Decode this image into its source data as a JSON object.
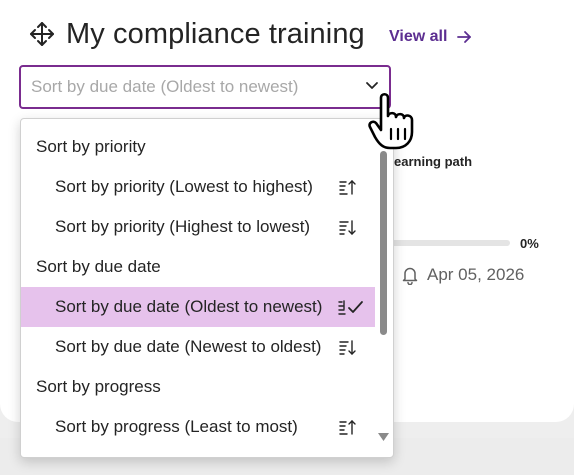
{
  "header": {
    "title": "My compliance training",
    "view_all": "View all"
  },
  "sort_select": {
    "placeholder": "Sort by due date (Oldest to newest)"
  },
  "background_card": {
    "learning_path": "earning path",
    "progress_percent": "0%",
    "due_date": "Apr 05, 2026"
  },
  "dropdown": {
    "groups": [
      {
        "label": "Sort by priority",
        "options": [
          {
            "label": "Sort by priority (Lowest to highest)",
            "icon": "sort-ascending-icon",
            "selected": false
          },
          {
            "label": "Sort by priority (Highest to lowest)",
            "icon": "sort-descending-icon",
            "selected": false
          }
        ]
      },
      {
        "label": "Sort by due date",
        "options": [
          {
            "label": "Sort by due date (Oldest to newest)",
            "icon": "sort-ascending-icon",
            "selected": true
          },
          {
            "label": "Sort by due date (Newest to oldest)",
            "icon": "sort-descending-icon",
            "selected": false
          }
        ]
      },
      {
        "label": "Sort by progress",
        "options": [
          {
            "label": "Sort by progress (Least to most)",
            "icon": "sort-ascending-icon",
            "selected": false
          }
        ]
      }
    ]
  },
  "colors": {
    "accent": "#7a2c8f",
    "link": "#5c2e91",
    "selected_bg": "#e6c2ec"
  }
}
